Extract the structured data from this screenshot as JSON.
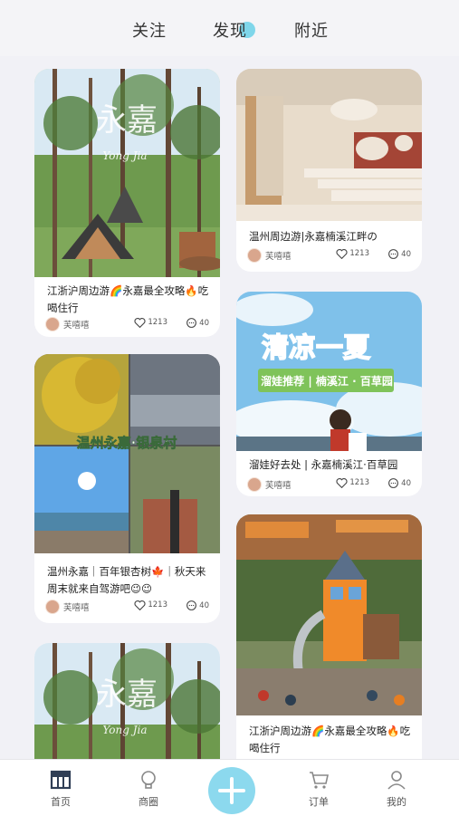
{
  "top_tabs": {
    "follow": "关注",
    "discover": "发现",
    "nearby": "附近"
  },
  "cards": [
    {
      "title": "江浙沪周边游🌈永嘉最全攻略🔥吃喝住行",
      "overlay_text": "永嘉",
      "overlay_sub": "Yong Jia",
      "author": "芙嘻嘻",
      "likes": "1213",
      "comments": "40"
    },
    {
      "title": "温州周边游|永嘉楠溪江畔の",
      "author": "芙嘻嘻",
      "likes": "1213",
      "comments": "40"
    },
    {
      "title": "温州永嘉｜百年银杏树🍁｜秋天来周末就来自驾游吧😉😉",
      "overlay_text": "温州永嘉·银泉村",
      "author": "芙嘻嘻",
      "likes": "1213",
      "comments": "40"
    },
    {
      "title": "溜娃好去处 | 永嘉楠溪江·百草园",
      "overlay_title": "清凉一夏",
      "overlay_sub": "溜娃推荐 | 楠溪江 · 百草园",
      "author": "芙嘻嘻",
      "likes": "1213",
      "comments": "40"
    },
    {
      "overlay_text": "永嘉",
      "overlay_sub": "Yong Jia"
    },
    {
      "title": "江浙沪周边游🌈永嘉最全攻略🔥吃喝住行"
    }
  ],
  "bottom_nav": {
    "home": "首页",
    "circle": "商圈",
    "orders": "订单",
    "mine": "我的"
  }
}
